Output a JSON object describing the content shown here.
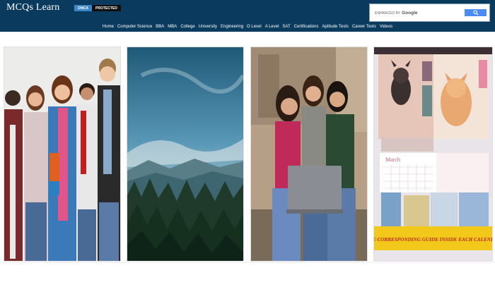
{
  "header": {
    "logo_text": "MCQs Learn",
    "badges": [
      "DMCA",
      "PROTECTED"
    ],
    "bg_color": "#0a3a5e"
  },
  "search": {
    "enhanced_label": "ENHANCED BY",
    "google_label": "Google",
    "button_icon": "search-icon"
  },
  "nav": {
    "items": [
      "Home",
      "Computer Science",
      "BBA",
      "MBA",
      "College",
      "University",
      "Engineering",
      "O Level",
      "A Level",
      "SAT",
      "Certifications",
      "Aptitude Tests",
      "Career Tests",
      "Videos"
    ]
  },
  "gallery": {
    "images": [
      {
        "alt": "students-group-photo"
      },
      {
        "alt": "forest-mountain-landscape"
      },
      {
        "alt": "students-with-laptop"
      },
      {
        "alt": "pets-calendar-promo"
      }
    ],
    "calendar_month": "March",
    "calendar_banner": "FREE CORRESPONDING GUIDE INSIDE EACH CALENDAR!"
  }
}
